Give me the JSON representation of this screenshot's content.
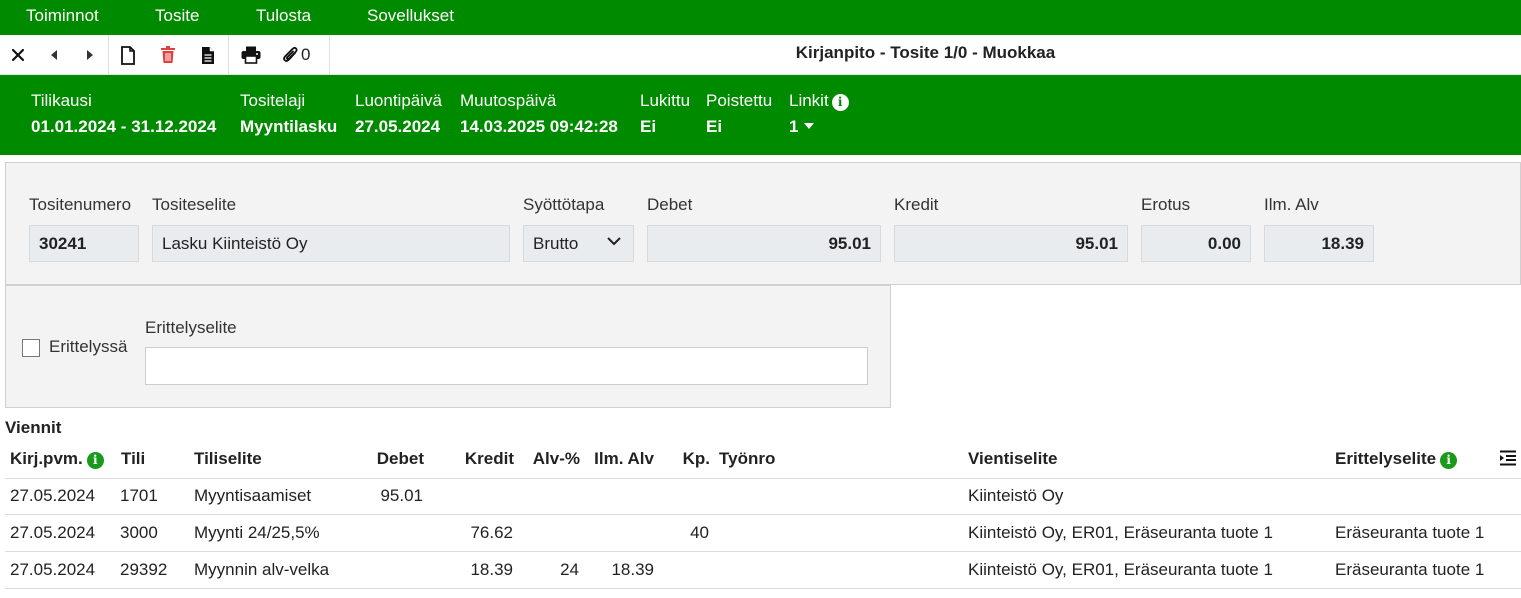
{
  "menu": [
    "Toiminnot",
    "Tosite",
    "Tulosta",
    "Sovellukset"
  ],
  "toolbar": {
    "title": "Kirjanpito - Tosite 1/0 - Muokkaa",
    "attachment_count": "0",
    "icons": [
      "close-icon",
      "prev-icon",
      "next-icon",
      "new-document-icon",
      "delete-icon",
      "document-text-icon",
      "print-icon",
      "attachment-icon"
    ]
  },
  "header": {
    "tilikausi": {
      "label": "Tilikausi",
      "value": "01.01.2024 - 31.12.2024"
    },
    "tositelaji": {
      "label": "Tositelaji",
      "value": "Myyntilasku"
    },
    "luontipaiva": {
      "label": "Luontipäivä",
      "value": "27.05.2024"
    },
    "muutospaiva": {
      "label": "Muutospäivä",
      "value": "14.03.2025 09:42:28"
    },
    "lukittu": {
      "label": "Lukittu",
      "value": "Ei"
    },
    "poistettu": {
      "label": "Poistettu",
      "value": "Ei"
    },
    "linkit": {
      "label": "Linkit",
      "value": "1"
    }
  },
  "form": {
    "tositenumero": {
      "label": "Tositenumero",
      "value": "30241"
    },
    "tositeselite": {
      "label": "Tositeselite",
      "value": "Lasku Kiinteistö Oy"
    },
    "syottotapa": {
      "label": "Syöttötapa",
      "value": "Brutto"
    },
    "debet": {
      "label": "Debet",
      "value": "95.01"
    },
    "kredit": {
      "label": "Kredit",
      "value": "95.01"
    },
    "erotus": {
      "label": "Erotus",
      "value": "0.00"
    },
    "ilm_alv": {
      "label": "Ilm. Alv",
      "value": "18.39"
    }
  },
  "erittely": {
    "checkbox_label": "Erittelyssä",
    "checked": false,
    "selite_label": "Erittelyselite",
    "selite_value": ""
  },
  "viennit": {
    "title": "Viennit",
    "columns": {
      "kirjpvm": "Kirj.pvm.",
      "tili": "Tili",
      "tiliselite": "Tiliselite",
      "debet": "Debet",
      "kredit": "Kredit",
      "alv": "Alv-%",
      "ilmalv": "Ilm. Alv",
      "kp": "Kp.",
      "tyonro": "Työnro",
      "vientiselite": "Vientiselite",
      "erittelyselite": "Erittelyselite"
    },
    "rows": [
      {
        "kirjpvm": "27.05.2024",
        "tili": "1701",
        "tiliselite": "Myyntisaamiset",
        "debet": "95.01",
        "kredit": "",
        "alv": "",
        "ilmalv": "",
        "kp": "",
        "tyonro": "",
        "vientiselite": "Kiinteistö Oy",
        "erittelyselite": ""
      },
      {
        "kirjpvm": "27.05.2024",
        "tili": "3000",
        "tiliselite": "Myynti 24/25,5%",
        "debet": "",
        "kredit": "76.62",
        "alv": "",
        "ilmalv": "",
        "kp": "40",
        "tyonro": "",
        "vientiselite": "Kiinteistö Oy, ER01, Eräseuranta tuote 1",
        "erittelyselite": "Eräseuranta tuote 1"
      },
      {
        "kirjpvm": "27.05.2024",
        "tili": "29392",
        "tiliselite": "Myynnin alv-velka",
        "debet": "",
        "kredit": "18.39",
        "alv": "24",
        "ilmalv": "18.39",
        "kp": "",
        "tyonro": "",
        "vientiselite": "Kiinteistö Oy, ER01, Eräseuranta tuote 1",
        "erittelyselite": "Eräseuranta tuote 1"
      }
    ]
  },
  "colors": {
    "brand_green": "#008a00",
    "delete_red": "#e04040"
  }
}
